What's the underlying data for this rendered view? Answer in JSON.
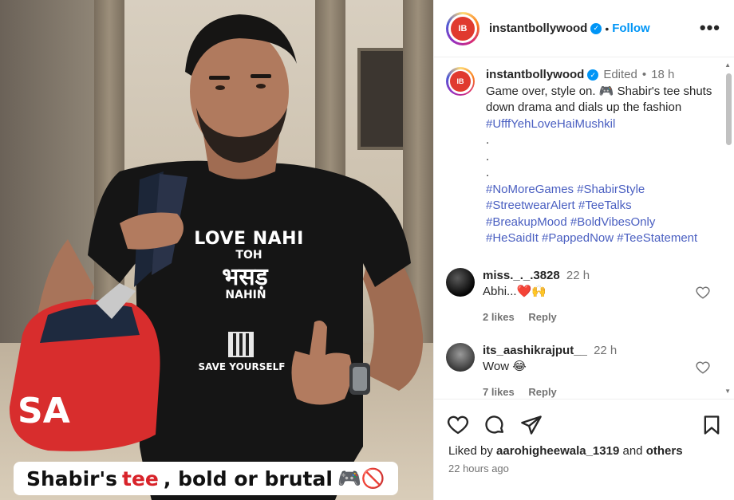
{
  "post_image": {
    "shirt_text": {
      "line1": "LOVE NAHI",
      "line2": "TOH",
      "line3": "भसड़",
      "line4": "NAHIN",
      "line5": "SAVE YOURSELF"
    },
    "bag_letters": "SA",
    "caption_banner": {
      "part1": "Shabir's ",
      "highlight": "tee",
      "part2": ", bold or brutal",
      "emoji": "🎮🚫"
    }
  },
  "header": {
    "username": "instantbollywood",
    "separator": "•",
    "follow_label": "Follow",
    "more_label": "•••",
    "avatar_text": "IB"
  },
  "caption": {
    "username": "instantbollywood",
    "edited": "Edited",
    "separator": "•",
    "time": "18 h",
    "text": "Game over, style on. 🎮 Shabir's tee shuts down drama and dials up the fashion ",
    "first_hashtag": "#UfffYehLoveHaiMushkil",
    "dots": [
      ".",
      ".",
      "."
    ],
    "hashtag_lines": [
      "#NoMoreGames #ShabirStyle",
      "#StreetwearAlert #TeeTalks",
      "#BreakupMood #BoldVibesOnly",
      "#HeSaidIt #PappedNow #TeeStatement"
    ]
  },
  "comments": [
    {
      "username": "miss._._.3828",
      "time": "22 h",
      "text": "Abhi...❤️🙌",
      "likes": "2 likes",
      "reply": "Reply"
    },
    {
      "username": "its_aashikrajput__",
      "time": "22 h",
      "text": "Wow 😂",
      "likes": "7 likes",
      "reply": "Reply"
    }
  ],
  "footer": {
    "liked_by_prefix": "Liked by ",
    "liked_by_user": "aarohigheewala_1319",
    "and_text": " and ",
    "others": "others",
    "time_ago": "22 hours ago"
  },
  "icons": [
    "heart-icon",
    "comment-icon",
    "share-icon",
    "bookmark-icon",
    "verified-icon",
    "more-icon"
  ],
  "colors": {
    "link": "#0095f6",
    "hashtag": "#4a5fc1",
    "muted": "#737373",
    "text": "#262626",
    "banner_highlight": "#d8232a"
  }
}
